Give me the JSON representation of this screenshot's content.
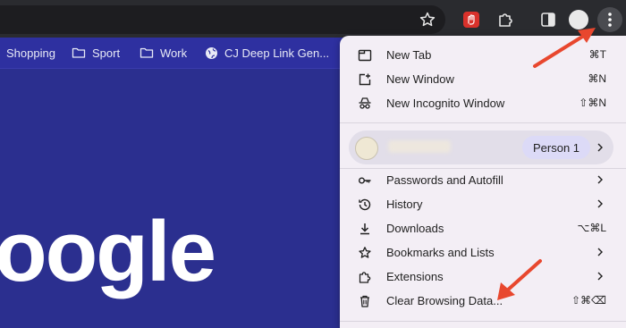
{
  "toolbar": {
    "icons": [
      "star-icon",
      "extension-red-icon",
      "puzzle-icon",
      "sidebar-icon",
      "avatar",
      "more-vert-icon"
    ]
  },
  "bookmarks": [
    {
      "label": "Shopping",
      "icon": "none"
    },
    {
      "label": "Sport",
      "icon": "folder-icon"
    },
    {
      "label": "Work",
      "icon": "folder-icon"
    },
    {
      "label": "CJ Deep Link Gen...",
      "icon": "globe-icon"
    }
  ],
  "page": {
    "logo_text": "oogle"
  },
  "menu": {
    "top_items": [
      {
        "label": "New Tab",
        "shortcut": "⌘T",
        "icon": "new-tab-icon"
      },
      {
        "label": "New Window",
        "shortcut": "⌘N",
        "icon": "new-window-icon"
      },
      {
        "label": "New Incognito Window",
        "shortcut": "⇧⌘N",
        "icon": "incognito-icon"
      }
    ],
    "profile": {
      "person_label": "Person 1"
    },
    "items": [
      {
        "label": "Passwords and Autofill",
        "icon": "key-icon",
        "has_submenu": true
      },
      {
        "label": "History",
        "icon": "history-icon",
        "has_submenu": true
      },
      {
        "label": "Downloads",
        "icon": "download-icon",
        "shortcut": "⌥⌘L"
      },
      {
        "label": "Bookmarks and Lists",
        "icon": "star-icon",
        "has_submenu": true
      },
      {
        "label": "Extensions",
        "icon": "puzzle-icon",
        "has_submenu": true
      },
      {
        "label": "Clear Browsing Data...",
        "icon": "trash-icon",
        "shortcut": "⇧⌘⌫"
      }
    ]
  },
  "annotations": {
    "arrow_color": "#e8472e"
  }
}
